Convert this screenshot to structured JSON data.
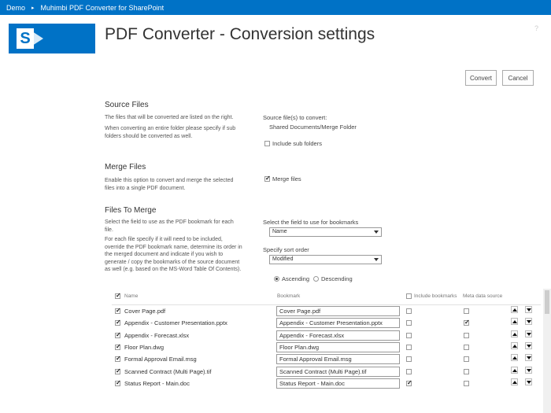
{
  "topbar": {
    "crumbs": [
      "Demo",
      "Muhimbi PDF Converter for SharePoint"
    ],
    "separator": "▸"
  },
  "header": {
    "logo_letter": "S",
    "title": "PDF Converter - Conversion settings",
    "help": "?"
  },
  "actions": {
    "convert": "Convert",
    "cancel": "Cancel"
  },
  "source_files": {
    "title": "Source Files",
    "desc1": "The files that will be converted are listed on the right.",
    "desc2": "When converting an entire folder please specify if sub folders should be converted as well.",
    "label": "Source file(s) to convert:",
    "path": "Shared Documents/Merge Folder",
    "include_sub": "Include sub folders",
    "include_sub_checked": false
  },
  "merge_files": {
    "title": "Merge Files",
    "desc": "Enable this option to convert and merge the selected files into a single PDF document.",
    "merge_label": "Merge files",
    "merge_checked": true
  },
  "files_to_merge": {
    "title": "Files To Merge",
    "desc1": "Select the field to use as the PDF bookmark for each file.",
    "desc2": "For each file specify if it will need to be included, override the PDF bookmark name, determine its order in the merged document and indicate if you wish to generate / copy the bookmarks of the source document as well (e.g. based on the MS-Word Table Of Contents).",
    "bookmark_field_label": "Select the field to use for bookmarks",
    "bookmark_field_value": "Name",
    "sort_label": "Specify sort order",
    "sort_value": "Modified",
    "ascending": "Ascending",
    "descending": "Descending",
    "sort_direction": "ascending"
  },
  "grid": {
    "headers": {
      "name": "Name",
      "bookmark": "Bookmark",
      "include_bookmarks": "Include bookmarks",
      "meta": "Meta data source"
    },
    "rows": [
      {
        "name": "Cover Page.pdf",
        "bookmark": "Cover Page.pdf",
        "selected": true,
        "include_bookmarks": false,
        "meta": false
      },
      {
        "name": "Appendix - Customer Presentation.pptx",
        "bookmark": "Appendix - Customer Presentation.pptx",
        "selected": true,
        "include_bookmarks": false,
        "meta": true
      },
      {
        "name": "Appendix - Forecast.xlsx",
        "bookmark": "Appendix - Forecast.xlsx",
        "selected": true,
        "include_bookmarks": false,
        "meta": false
      },
      {
        "name": "Floor Plan.dwg",
        "bookmark": "Floor Plan.dwg",
        "selected": true,
        "include_bookmarks": false,
        "meta": false
      },
      {
        "name": "Formal Approval Email.msg",
        "bookmark": "Formal Approval Email.msg",
        "selected": true,
        "include_bookmarks": false,
        "meta": false
      },
      {
        "name": "Scanned Contract (Multi Page).tif",
        "bookmark": "Scanned Contract (Multi Page).tif",
        "selected": true,
        "include_bookmarks": false,
        "meta": false
      },
      {
        "name": "Status Report - Main.doc",
        "bookmark": "Status Report - Main.doc",
        "selected": true,
        "include_bookmarks": true,
        "meta": false
      }
    ]
  },
  "colors": {
    "brand": "#0072c6"
  }
}
